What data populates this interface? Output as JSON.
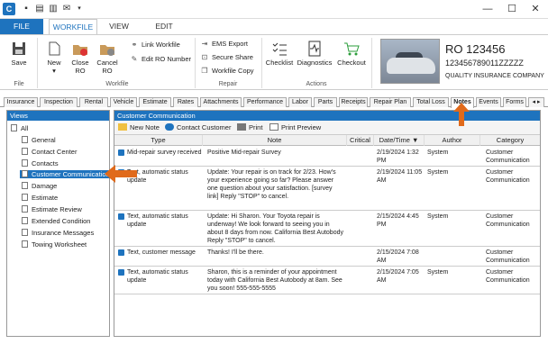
{
  "titlebar": {
    "app_icon": "C",
    "quick_access": [
      "save-icon",
      "print-icon",
      "print-preview-icon",
      "envelope-icon",
      "dropdown-icon"
    ],
    "window": {
      "minimize": "—",
      "restore": "☐",
      "close": "✕"
    }
  },
  "ribbon_tabs": [
    "FILE",
    "WORKFILE",
    "VIEW",
    "EDIT"
  ],
  "ribbon": {
    "save": "Save",
    "new": "New",
    "close_ro": "Close RO",
    "cancel_ro": "Cancel RO",
    "link_workfile": "Link Workfile",
    "edit_ro_number": "Edit RO Number",
    "ems_export": "EMS Export",
    "secure_share": "Secure Share",
    "workfile_copy": "Workfile Copy",
    "checklist": "Checklist",
    "diagnostics": "Diagnostics",
    "checkout": "Checkout",
    "groups": {
      "file": "File",
      "workfile": "Workfile",
      "repair": "Repair",
      "actions": "Actions"
    }
  },
  "ro": {
    "title": "RO 123456",
    "vin": "123456789011ZZZZZ",
    "insurance": "QUALITY INSURANCE COMPANY"
  },
  "doc_tabs": [
    "Insurance",
    "Inspection",
    "Rental",
    "Vehicle",
    "Estimate",
    "Rates",
    "Attachments",
    "Performance",
    "Labor",
    "Parts",
    "Receipts",
    "Repair Plan",
    "Total Loss",
    "Notes",
    "Events",
    "Forms"
  ],
  "doc_tab_active": "Notes",
  "doc_tab_scroll": "◂ ▸",
  "views": {
    "header": "Views",
    "root": "All",
    "items": [
      "General",
      "Contact Center",
      "Contacts",
      "Customer Communication",
      "Damage",
      "Estimate",
      "Estimate Review",
      "Extended Condition",
      "Insurance Messages",
      "Towing Worksheet"
    ],
    "selected": "Customer Communication"
  },
  "main": {
    "header": "Customer Communication",
    "toolbar": {
      "new_note": "New Note",
      "contact_customer": "Contact Customer",
      "print": "Print",
      "print_preview": "Print Preview"
    },
    "columns": {
      "type": "Type",
      "note": "Note",
      "critical": "Critical",
      "date_time": "Date/Time",
      "author": "Author",
      "category": "Category"
    },
    "sort_indicator": "▼",
    "rows": [
      {
        "type": "Mid-repair survey received",
        "note": "Positive Mid-repair Survey",
        "critical": "",
        "date": "2/19/2024 1:32 PM",
        "author": "System",
        "category": "Customer Communication"
      },
      {
        "type": "Text, automatic status update",
        "note": "Update: Your repair is on track for 2/23. How's your experience going so far? Please answer one question about your satisfaction. [survey link] Reply \"STOP\" to cancel.",
        "critical": "",
        "date": "2/19/2024 11:05 AM",
        "author": "System",
        "category": "Customer Communication"
      },
      {
        "type": "Text, automatic status update",
        "note": "Update: Hi Sharon. Your Toyota repair is underway! We look forward to seeing you in about 8 days from now. California Best Autobody Reply \"STOP\" to cancel.",
        "critical": "",
        "date": "2/15/2024 4:45 PM",
        "author": "System",
        "category": "Customer Communication"
      },
      {
        "type": "Text, customer message",
        "note": "Thanks! I'll be there.",
        "critical": "",
        "date": "2/15/2024 7:08 AM",
        "author": "",
        "category": "Customer Communication"
      },
      {
        "type": "Text, automatic status update",
        "note": "Sharon, this is a reminder of your appointment today with California Best Autobody at 8am. See you soon! 555-555-5555",
        "critical": "",
        "date": "2/15/2024 7:05 AM",
        "author": "System",
        "category": "Customer Communication"
      }
    ]
  },
  "colors": {
    "accent": "#1e73be",
    "arrow": "#e06a1b"
  }
}
